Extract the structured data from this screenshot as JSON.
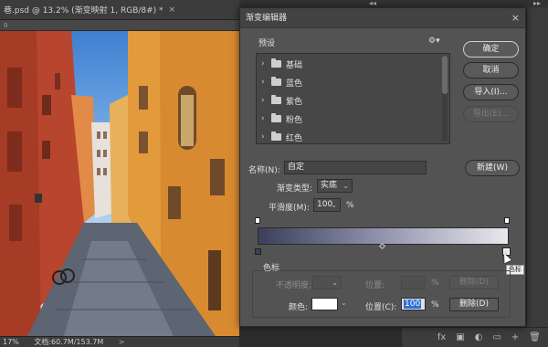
{
  "document": {
    "tab_title": "巷.psd @ 13.2% (渐变映射 1, RGB/8#) *",
    "close_glyph": "×",
    "ruler_label": "0",
    "zoom": "17%",
    "doc_size": "文档:60.7M/153.7M"
  },
  "dialog": {
    "title": "渐变编辑器",
    "close_glyph": "×",
    "presets_label": "预设",
    "gear_icon": "gear-icon",
    "preset_folders": [
      {
        "label": "基础"
      },
      {
        "label": "蓝色"
      },
      {
        "label": "紫色"
      },
      {
        "label": "粉色"
      },
      {
        "label": "红色"
      }
    ],
    "buttons": {
      "ok": "确定",
      "cancel": "取消",
      "import": "导入(I)...",
      "export": "导出(E)...",
      "new": "新建(W)"
    },
    "name_label": "名称(N):",
    "name_value": "自定",
    "type_label": "渐变类型:",
    "type_value": "实底",
    "smoothness_label": "平滑度(M):",
    "smoothness_value": "100",
    "percent_sign": "%",
    "gradient": {
      "start_color": "#3b3f5c",
      "mid_color": "#8a8ca8",
      "end_color": "#e8e8ec"
    },
    "stops_group_label": "色标",
    "opacity_label": "不透明度:",
    "location_label_top": "位置:",
    "delete_label_top": "删除(D)",
    "color_label": "颜色:",
    "color_value": "#ffffff",
    "location_label": "位置(C):",
    "location_value": "100",
    "delete_label": "删除(D)",
    "tooltip": "色标"
  },
  "chrome": {
    "collapse_glyph": "◂◂",
    "collapse_glyph_right": "▸▸",
    "panel_icons": [
      "fx",
      "▣",
      "◐",
      "▭",
      "+",
      "🗑"
    ]
  }
}
